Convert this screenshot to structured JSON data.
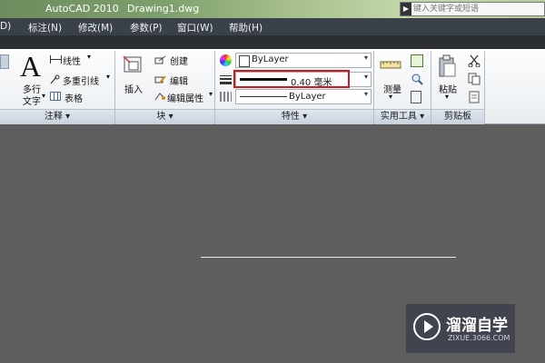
{
  "title": {
    "app": "AutoCAD 2010",
    "document": "Drawing1.dwg"
  },
  "search": {
    "placeholder": "键入关键字或短语"
  },
  "menu": {
    "items": [
      "D)",
      "标注(N)",
      "修改(M)",
      "参数(P)",
      "窗口(W)",
      "帮助(H)"
    ]
  },
  "ribbon": {
    "annotation": {
      "text_big": "A",
      "multiline_text_1": "多行",
      "multiline_text_2": "文字",
      "linear": "线性",
      "mleader": "多重引线",
      "table": "表格",
      "panel": "注释"
    },
    "block": {
      "insert": "插入",
      "create": "创建",
      "edit": "编辑",
      "edit_attr": "编辑属性",
      "panel": "块"
    },
    "properties": {
      "color": "ByLayer",
      "lineweight": "0.40 毫米",
      "linetype": "ByLayer",
      "panel": "特性"
    },
    "utilities": {
      "measure": "测量",
      "panel": "实用工具"
    },
    "clipboard": {
      "paste": "粘贴",
      "panel": "剪贴板"
    }
  },
  "watermark": {
    "brand": "溜溜自学",
    "url": "ZIXUE.3066.COM"
  },
  "colors": {
    "highlight_box": "#d0191f",
    "canvas": "#5e5e5e"
  }
}
